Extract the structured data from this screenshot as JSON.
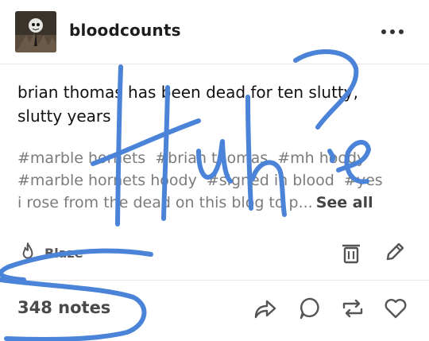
{
  "post": {
    "username": "bloodcounts",
    "body": "brian thomas has been dead for ten slutty, slutty years",
    "tags": [
      "#marble hornets",
      "#brian thomas",
      "#mh hoody",
      "#marble hornets hoody",
      "#signed in blood",
      "#yes"
    ],
    "tag_truncated": "i rose from the dead on this blog to p...",
    "see_all": "See all",
    "blaze_label": "Blaze",
    "notes": "348 notes"
  },
  "overlay": {
    "handwriting": "Huh?",
    "ink_color": "#4a83d8"
  },
  "icons": [
    "more-icon",
    "flame-icon",
    "trash-icon",
    "edit-icon",
    "share-icon",
    "reply-icon",
    "reblog-icon",
    "heart-icon"
  ]
}
